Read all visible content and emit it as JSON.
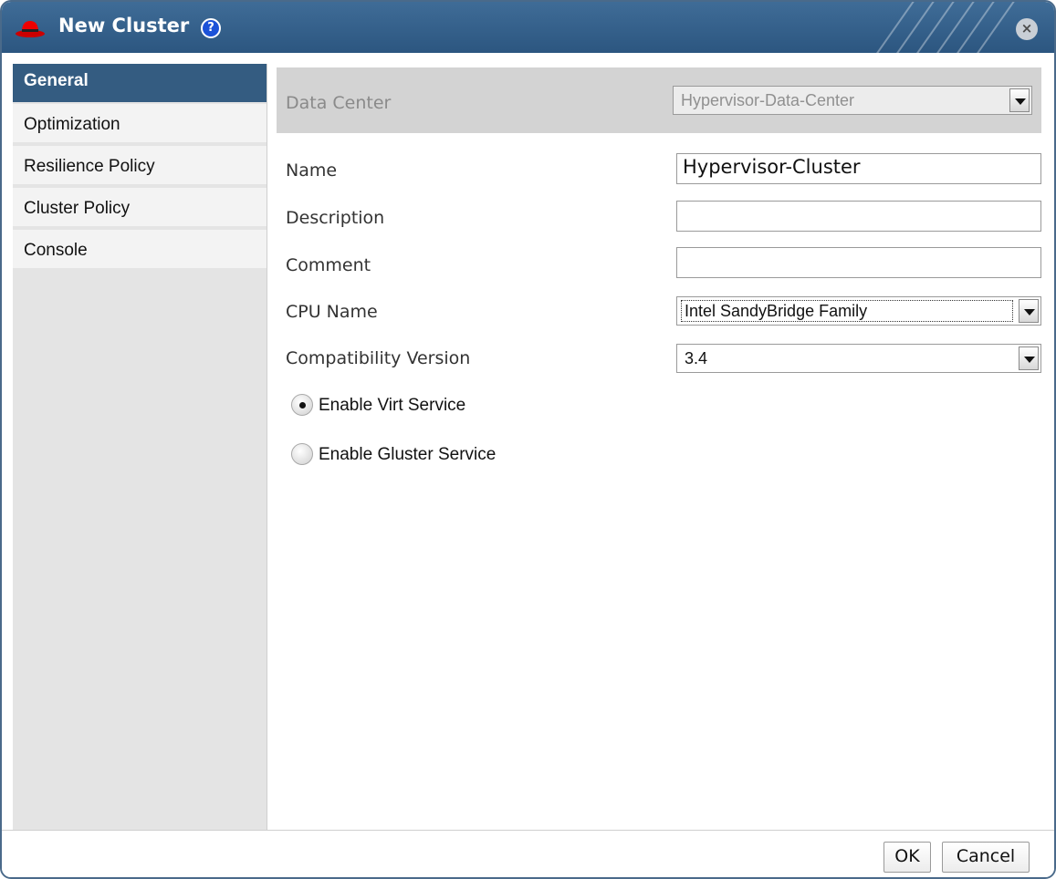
{
  "dialog": {
    "title": "New Cluster",
    "help_glyph": "?",
    "close_glyph": "×",
    "title_icon": "red-hat-icon",
    "title_bar_color": "#2f5b86"
  },
  "sidebar": {
    "items": [
      {
        "label": "General",
        "active": true
      },
      {
        "label": "Optimization",
        "active": false
      },
      {
        "label": "Resilience Policy",
        "active": false
      },
      {
        "label": "Cluster Policy",
        "active": false
      },
      {
        "label": "Console",
        "active": false
      }
    ],
    "active_color": "#345c81"
  },
  "form": {
    "data_center": {
      "label": "Data Center",
      "value": "Hypervisor-Data-Center",
      "disabled": true
    },
    "name": {
      "label": "Name",
      "value": "Hypervisor-Cluster"
    },
    "description": {
      "label": "Description",
      "value": ""
    },
    "comment": {
      "label": "Comment",
      "value": ""
    },
    "cpu_name": {
      "label": "CPU Name",
      "value": "Intel SandyBridge Family"
    },
    "compatibility_version": {
      "label": "Compatibility Version",
      "value": "3.4"
    },
    "services": [
      {
        "label": "Enable Virt Service",
        "checked": true
      },
      {
        "label": "Enable Gluster Service",
        "checked": false
      }
    ]
  },
  "footer": {
    "ok_label": "OK",
    "cancel_label": "Cancel"
  }
}
